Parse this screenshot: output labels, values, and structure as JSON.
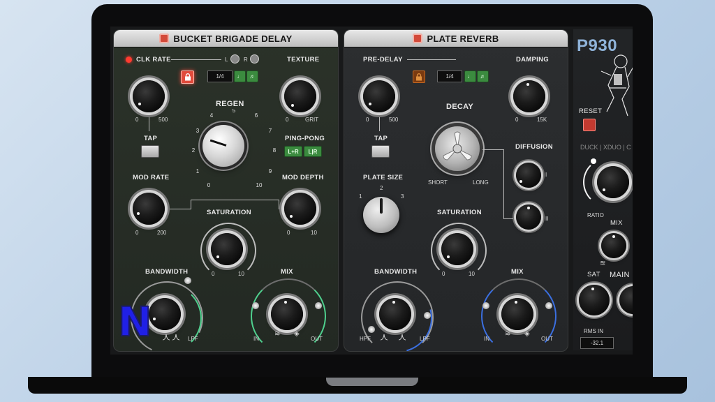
{
  "bbd": {
    "title": "BUCKET BRIGADE DELAY",
    "clk_rate": "CLK RATE",
    "clk_min": "0",
    "clk_max": "500",
    "l": "L",
    "r": "R",
    "division": "1/4",
    "texture": "TEXTURE",
    "tex_min": "0",
    "tex_max": "GRIT",
    "regen": "REGEN",
    "regen_ticks": [
      "0",
      "1",
      "2",
      "3",
      "4",
      "5",
      "6",
      "7",
      "8",
      "9",
      "10"
    ],
    "tap": "TAP",
    "ping_pong": "PING-PONG",
    "lr_sum": "L+R",
    "lr_split": "L|R",
    "mod_rate": "MOD RATE",
    "mr_min": "0",
    "mr_max": "200",
    "mod_depth": "MOD DEPTH",
    "md_min": "0",
    "md_max": "10",
    "saturation": "SATURATION",
    "sat_min": "0",
    "sat_max": "10",
    "bandwidth": "BANDWIDTH",
    "lpf": "LPF",
    "mix": "MIX",
    "in": "IN",
    "out": "OUT"
  },
  "plate": {
    "title": "PLATE REVERB",
    "pre_delay": "PRE-DELAY",
    "pd_min": "0",
    "pd_max": "500",
    "division": "1/4",
    "damping": "DAMPING",
    "dmp_min": "0",
    "dmp_max": "15K",
    "decay": "DECAY",
    "short": "SHORT",
    "long": "LONG",
    "tap": "TAP",
    "diffusion": "DIFFUSION",
    "diff_1": "I",
    "diff_2": "II",
    "plate_size": "PLATE SIZE",
    "ps_1": "1",
    "ps_2": "2",
    "ps_3": "3",
    "saturation": "SATURATION",
    "sat_min": "0",
    "sat_max": "10",
    "bandwidth": "BANDWIDTH",
    "hpf": "HPF",
    "lpf": "LPF",
    "mix": "MIX",
    "in": "IN",
    "out": "OUT"
  },
  "side": {
    "logo": "P930",
    "reset": "RESET",
    "tabs": "DUCK | XDUO | C",
    "ratio": "RATIO",
    "mix": "MIX",
    "sat": "SAT",
    "main": "MAIN",
    "rms_in": "RMS IN",
    "rms_value": "-32.1"
  },
  "overlay": {
    "letter": "N"
  },
  "colors": {
    "accent_green": "#4fd08e",
    "accent_blue": "#3b6fe0",
    "led_red": "#ff3b30",
    "lock_red": "#e14b3c",
    "lock_orange": "#c96b22"
  }
}
